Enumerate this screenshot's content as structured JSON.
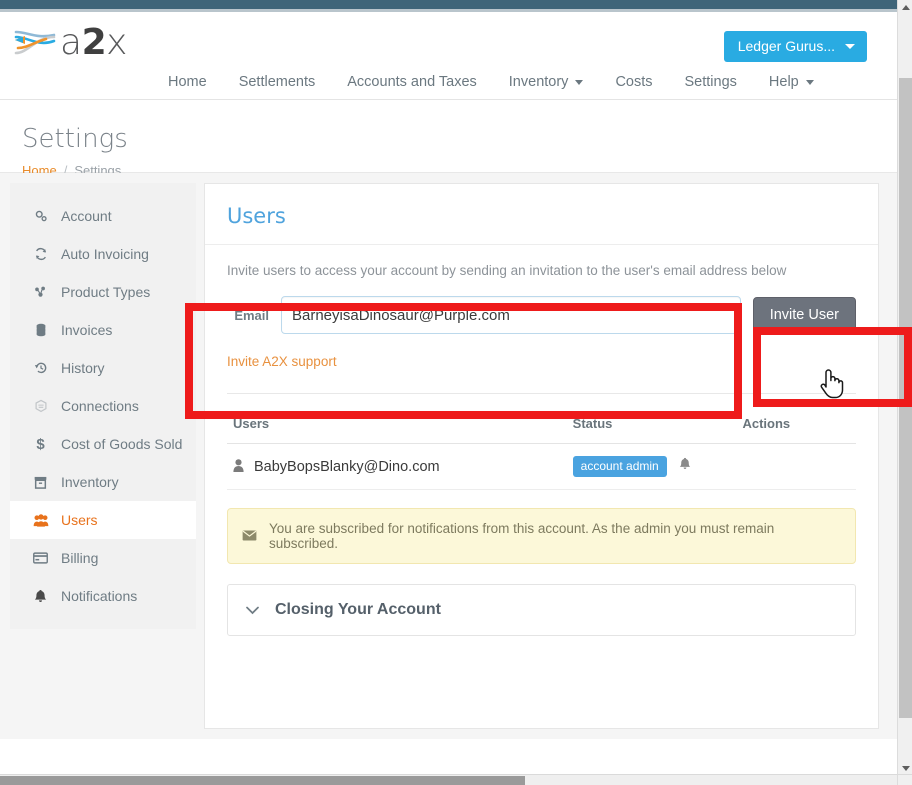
{
  "brand": {
    "logo_text_a": "a",
    "logo_text_2": "2",
    "logo_text_x": "x",
    "logo_icon": "a2x-logo-icon",
    "accent_blue": "#29abe2",
    "accent_orange": "#e8721c",
    "topbar_color": "#3f6579"
  },
  "header": {
    "account_button": "Ledger Gurus...",
    "account_caret_icon": "caret-down-icon",
    "nav": [
      {
        "label": "Home",
        "has_caret": false
      },
      {
        "label": "Settlements",
        "has_caret": false
      },
      {
        "label": "Accounts and Taxes",
        "has_caret": false
      },
      {
        "label": "Inventory",
        "has_caret": true
      },
      {
        "label": "Costs",
        "has_caret": false
      },
      {
        "label": "Settings",
        "has_caret": false
      },
      {
        "label": "Help",
        "has_caret": true
      }
    ]
  },
  "page": {
    "title": "Settings",
    "breadcrumb": {
      "home": "Home",
      "separator": "/",
      "current": "Settings"
    }
  },
  "sidebar": {
    "items": [
      {
        "label": "Account",
        "icon": "gears-icon",
        "glyph": "⚙",
        "active": false
      },
      {
        "label": "Auto Invoicing",
        "icon": "refresh-icon",
        "glyph": "↻",
        "active": false
      },
      {
        "label": "Product Types",
        "icon": "sitemap-icon",
        "glyph": "⚜",
        "active": false
      },
      {
        "label": "Invoices",
        "icon": "database-icon",
        "glyph": "☲",
        "active": false
      },
      {
        "label": "History",
        "icon": "history-icon",
        "glyph": "↺",
        "active": false
      },
      {
        "label": "Connections",
        "icon": "connections-icon",
        "glyph": "⬡",
        "active": false
      },
      {
        "label": "Cost of Goods Sold",
        "icon": "dollar-icon",
        "glyph": "$",
        "active": false
      },
      {
        "label": "Inventory",
        "icon": "archive-icon",
        "glyph": "▣",
        "active": false
      },
      {
        "label": "Users",
        "icon": "users-icon",
        "glyph": "●",
        "active": true
      },
      {
        "label": "Billing",
        "icon": "credit-card-icon",
        "glyph": "▤",
        "active": false
      },
      {
        "label": "Notifications",
        "icon": "bell-icon",
        "glyph": "ὑ4",
        "active": false
      }
    ]
  },
  "main": {
    "card_title": "Users",
    "invite": {
      "description": "Invite users to access your account by sending an invitation to the user's email address below",
      "email_label": "Email",
      "email_value": "BarneyisaDinosaur@Purple.com",
      "email_placeholder": "",
      "invite_button": "Invite User",
      "support_link": "Invite A2X support"
    },
    "table": {
      "headers": [
        "Users",
        "Status",
        "Actions"
      ],
      "rows": [
        {
          "user_icon": "user-icon",
          "user": "BabyBopsBlanky@Dino.com",
          "status_badge": "account admin",
          "status_icon": "bell-icon",
          "actions": ""
        }
      ]
    },
    "alert": {
      "icon": "envelope-icon",
      "text": "You are subscribed for notifications from this account. As the admin you must remain subscribed."
    },
    "panel": {
      "chevron_icon": "chevron-down-icon",
      "title": "Closing Your Account"
    }
  },
  "annotations": {
    "invite_form_box": "red-highlight-box",
    "invite_button_box": "red-highlight-box",
    "color": "#ee1b1b"
  },
  "cursor": {
    "icon": "pointing-hand-cursor"
  }
}
